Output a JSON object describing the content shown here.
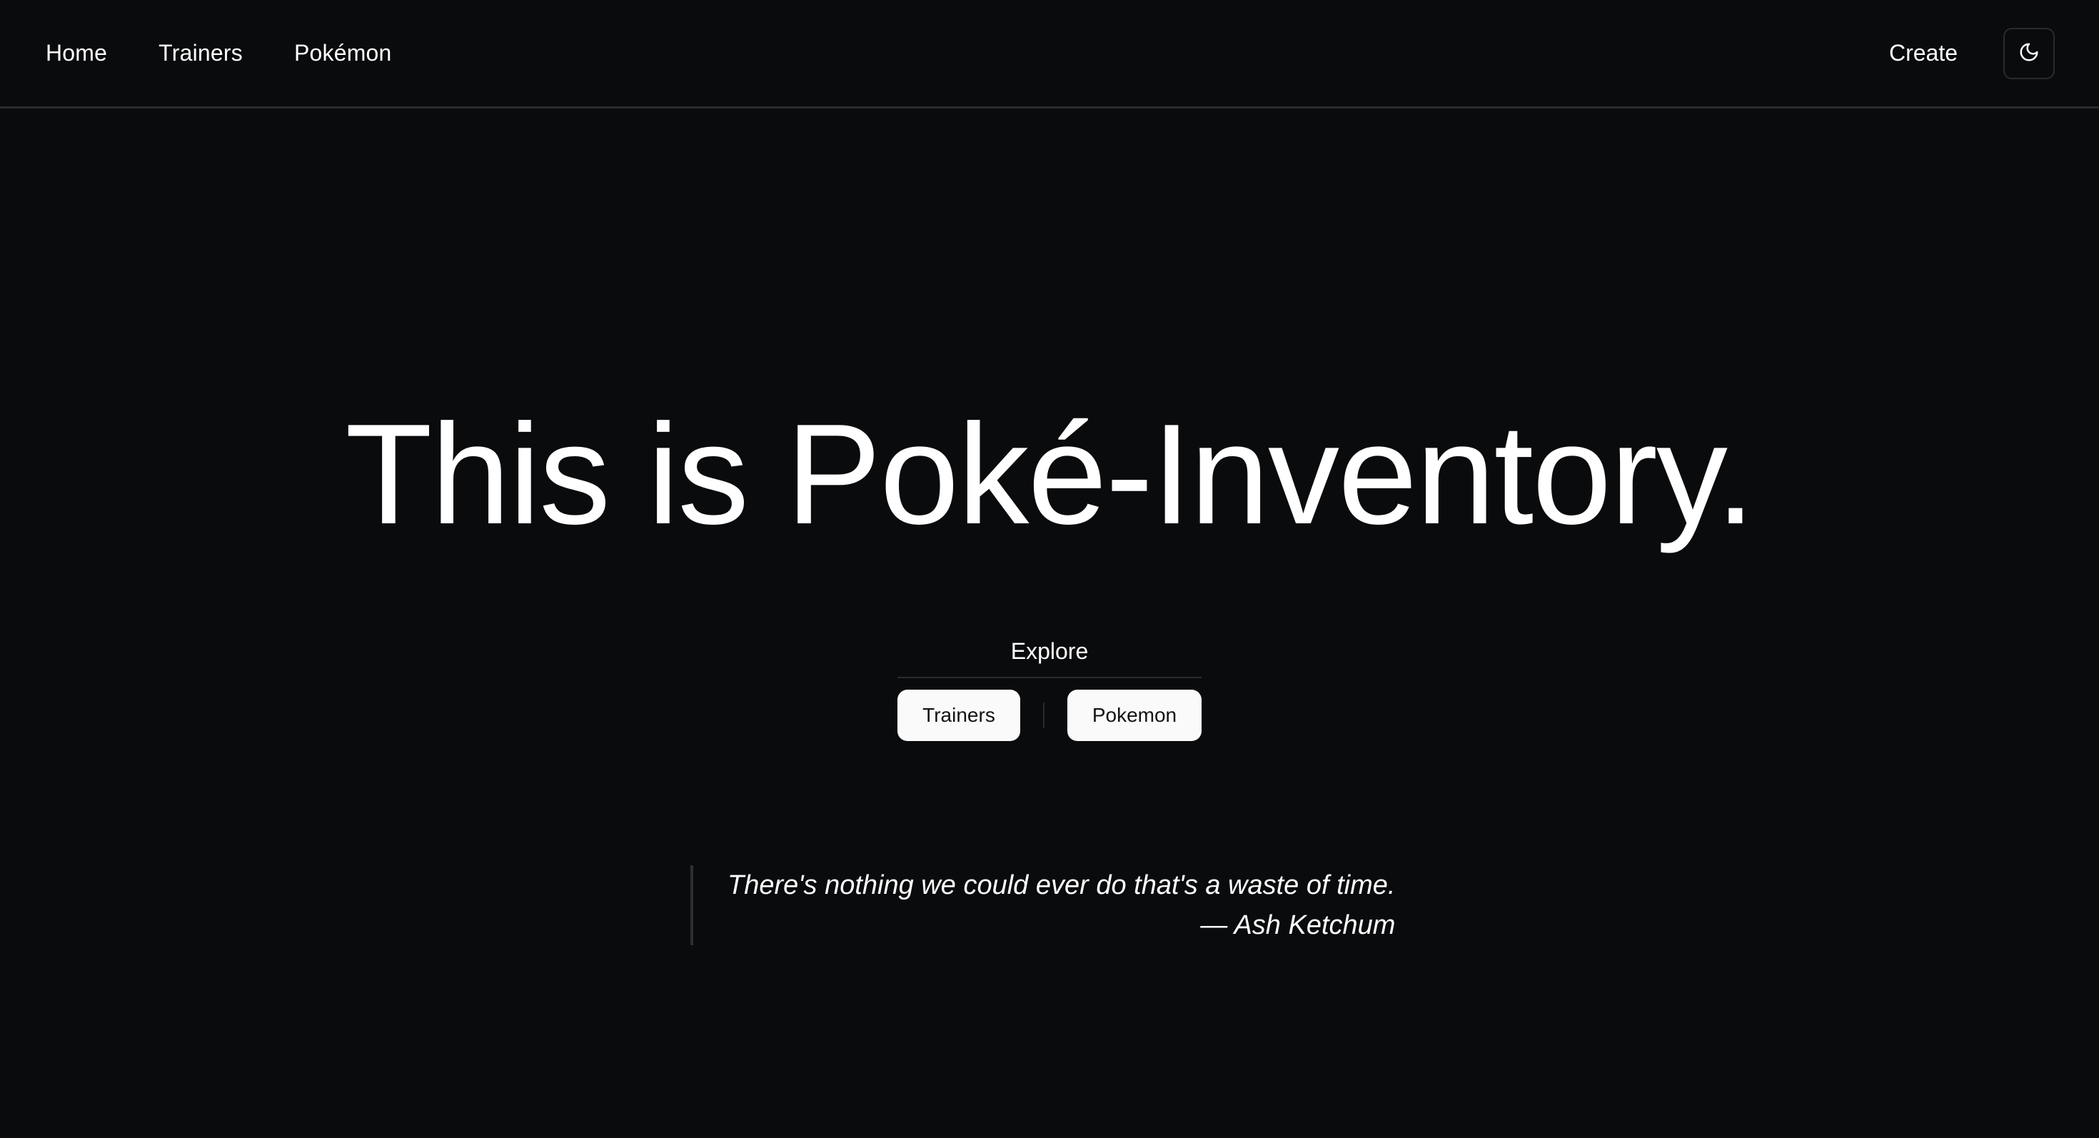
{
  "nav": {
    "links": [
      "Home",
      "Trainers",
      "Pokémon"
    ],
    "create_label": "Create",
    "theme_icon": "moon-icon"
  },
  "hero": {
    "title": "This is Poké-Inventory."
  },
  "explore": {
    "label": "Explore",
    "buttons": [
      "Trainers",
      "Pokemon"
    ]
  },
  "quote": {
    "text": "There's nothing we could ever do that's a waste of time.",
    "author": "— Ash Ketchum"
  },
  "colors": {
    "background": "#0a0b0d",
    "text": "#ffffff",
    "border": "#2a2b2e",
    "button_bg": "#fafafa",
    "button_text": "#111214"
  }
}
